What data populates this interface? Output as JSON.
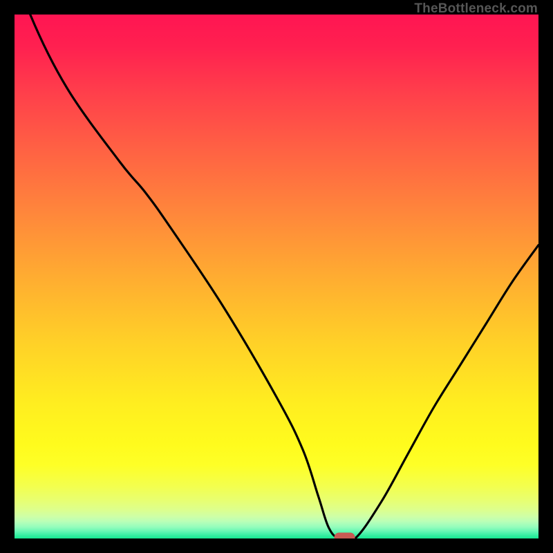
{
  "attribution": "TheBottleneck.com",
  "colors": {
    "border": "#000000",
    "curve": "#000000",
    "marker_fill": "#c85a54",
    "marker_stroke": "#c85a54"
  },
  "chart_data": {
    "type": "line",
    "title": "",
    "xlabel": "",
    "ylabel": "",
    "xlim": [
      0,
      100
    ],
    "ylim": [
      0,
      100
    ],
    "x": [
      0,
      3,
      10,
      20,
      25,
      30,
      40,
      50,
      55,
      58,
      60,
      62,
      65,
      70,
      75,
      80,
      85,
      90,
      95,
      100
    ],
    "values": [
      110,
      100,
      86,
      72,
      66,
      59,
      44,
      27,
      17,
      8,
      2,
      0,
      0,
      7,
      16,
      25,
      33,
      41,
      49,
      56
    ],
    "marker": {
      "x": 63,
      "y": 0,
      "shape": "rounded-rect"
    },
    "annotations": []
  }
}
